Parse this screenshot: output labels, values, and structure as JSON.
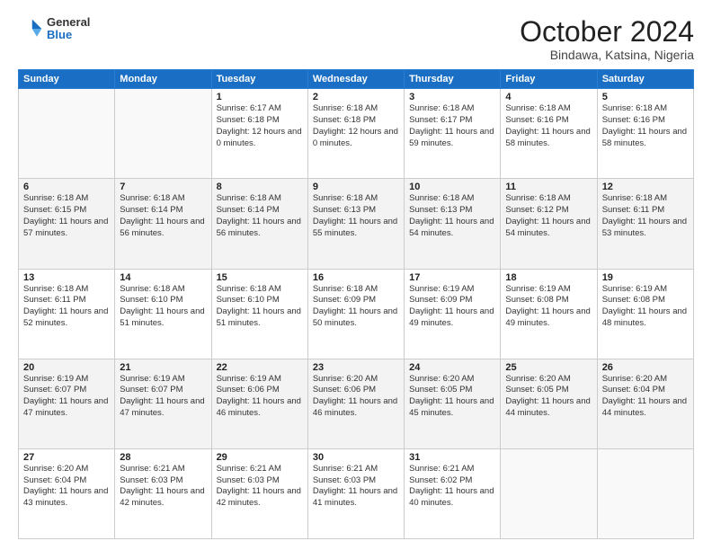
{
  "header": {
    "logo": {
      "general": "General",
      "blue": "Blue"
    },
    "title": "October 2024",
    "subtitle": "Bindawa, Katsina, Nigeria"
  },
  "weekdays": [
    "Sunday",
    "Monday",
    "Tuesday",
    "Wednesday",
    "Thursday",
    "Friday",
    "Saturday"
  ],
  "weeks": [
    [
      {
        "day": "",
        "sunrise": "",
        "sunset": "",
        "daylight": ""
      },
      {
        "day": "",
        "sunrise": "",
        "sunset": "",
        "daylight": ""
      },
      {
        "day": "1",
        "sunrise": "Sunrise: 6:17 AM",
        "sunset": "Sunset: 6:18 PM",
        "daylight": "Daylight: 12 hours and 0 minutes."
      },
      {
        "day": "2",
        "sunrise": "Sunrise: 6:18 AM",
        "sunset": "Sunset: 6:18 PM",
        "daylight": "Daylight: 12 hours and 0 minutes."
      },
      {
        "day": "3",
        "sunrise": "Sunrise: 6:18 AM",
        "sunset": "Sunset: 6:17 PM",
        "daylight": "Daylight: 11 hours and 59 minutes."
      },
      {
        "day": "4",
        "sunrise": "Sunrise: 6:18 AM",
        "sunset": "Sunset: 6:16 PM",
        "daylight": "Daylight: 11 hours and 58 minutes."
      },
      {
        "day": "5",
        "sunrise": "Sunrise: 6:18 AM",
        "sunset": "Sunset: 6:16 PM",
        "daylight": "Daylight: 11 hours and 58 minutes."
      }
    ],
    [
      {
        "day": "6",
        "sunrise": "Sunrise: 6:18 AM",
        "sunset": "Sunset: 6:15 PM",
        "daylight": "Daylight: 11 hours and 57 minutes."
      },
      {
        "day": "7",
        "sunrise": "Sunrise: 6:18 AM",
        "sunset": "Sunset: 6:14 PM",
        "daylight": "Daylight: 11 hours and 56 minutes."
      },
      {
        "day": "8",
        "sunrise": "Sunrise: 6:18 AM",
        "sunset": "Sunset: 6:14 PM",
        "daylight": "Daylight: 11 hours and 56 minutes."
      },
      {
        "day": "9",
        "sunrise": "Sunrise: 6:18 AM",
        "sunset": "Sunset: 6:13 PM",
        "daylight": "Daylight: 11 hours and 55 minutes."
      },
      {
        "day": "10",
        "sunrise": "Sunrise: 6:18 AM",
        "sunset": "Sunset: 6:13 PM",
        "daylight": "Daylight: 11 hours and 54 minutes."
      },
      {
        "day": "11",
        "sunrise": "Sunrise: 6:18 AM",
        "sunset": "Sunset: 6:12 PM",
        "daylight": "Daylight: 11 hours and 54 minutes."
      },
      {
        "day": "12",
        "sunrise": "Sunrise: 6:18 AM",
        "sunset": "Sunset: 6:11 PM",
        "daylight": "Daylight: 11 hours and 53 minutes."
      }
    ],
    [
      {
        "day": "13",
        "sunrise": "Sunrise: 6:18 AM",
        "sunset": "Sunset: 6:11 PM",
        "daylight": "Daylight: 11 hours and 52 minutes."
      },
      {
        "day": "14",
        "sunrise": "Sunrise: 6:18 AM",
        "sunset": "Sunset: 6:10 PM",
        "daylight": "Daylight: 11 hours and 51 minutes."
      },
      {
        "day": "15",
        "sunrise": "Sunrise: 6:18 AM",
        "sunset": "Sunset: 6:10 PM",
        "daylight": "Daylight: 11 hours and 51 minutes."
      },
      {
        "day": "16",
        "sunrise": "Sunrise: 6:18 AM",
        "sunset": "Sunset: 6:09 PM",
        "daylight": "Daylight: 11 hours and 50 minutes."
      },
      {
        "day": "17",
        "sunrise": "Sunrise: 6:19 AM",
        "sunset": "Sunset: 6:09 PM",
        "daylight": "Daylight: 11 hours and 49 minutes."
      },
      {
        "day": "18",
        "sunrise": "Sunrise: 6:19 AM",
        "sunset": "Sunset: 6:08 PM",
        "daylight": "Daylight: 11 hours and 49 minutes."
      },
      {
        "day": "19",
        "sunrise": "Sunrise: 6:19 AM",
        "sunset": "Sunset: 6:08 PM",
        "daylight": "Daylight: 11 hours and 48 minutes."
      }
    ],
    [
      {
        "day": "20",
        "sunrise": "Sunrise: 6:19 AM",
        "sunset": "Sunset: 6:07 PM",
        "daylight": "Daylight: 11 hours and 47 minutes."
      },
      {
        "day": "21",
        "sunrise": "Sunrise: 6:19 AM",
        "sunset": "Sunset: 6:07 PM",
        "daylight": "Daylight: 11 hours and 47 minutes."
      },
      {
        "day": "22",
        "sunrise": "Sunrise: 6:19 AM",
        "sunset": "Sunset: 6:06 PM",
        "daylight": "Daylight: 11 hours and 46 minutes."
      },
      {
        "day": "23",
        "sunrise": "Sunrise: 6:20 AM",
        "sunset": "Sunset: 6:06 PM",
        "daylight": "Daylight: 11 hours and 46 minutes."
      },
      {
        "day": "24",
        "sunrise": "Sunrise: 6:20 AM",
        "sunset": "Sunset: 6:05 PM",
        "daylight": "Daylight: 11 hours and 45 minutes."
      },
      {
        "day": "25",
        "sunrise": "Sunrise: 6:20 AM",
        "sunset": "Sunset: 6:05 PM",
        "daylight": "Daylight: 11 hours and 44 minutes."
      },
      {
        "day": "26",
        "sunrise": "Sunrise: 6:20 AM",
        "sunset": "Sunset: 6:04 PM",
        "daylight": "Daylight: 11 hours and 44 minutes."
      }
    ],
    [
      {
        "day": "27",
        "sunrise": "Sunrise: 6:20 AM",
        "sunset": "Sunset: 6:04 PM",
        "daylight": "Daylight: 11 hours and 43 minutes."
      },
      {
        "day": "28",
        "sunrise": "Sunrise: 6:21 AM",
        "sunset": "Sunset: 6:03 PM",
        "daylight": "Daylight: 11 hours and 42 minutes."
      },
      {
        "day": "29",
        "sunrise": "Sunrise: 6:21 AM",
        "sunset": "Sunset: 6:03 PM",
        "daylight": "Daylight: 11 hours and 42 minutes."
      },
      {
        "day": "30",
        "sunrise": "Sunrise: 6:21 AM",
        "sunset": "Sunset: 6:03 PM",
        "daylight": "Daylight: 11 hours and 41 minutes."
      },
      {
        "day": "31",
        "sunrise": "Sunrise: 6:21 AM",
        "sunset": "Sunset: 6:02 PM",
        "daylight": "Daylight: 11 hours and 40 minutes."
      },
      {
        "day": "",
        "sunrise": "",
        "sunset": "",
        "daylight": ""
      },
      {
        "day": "",
        "sunrise": "",
        "sunset": "",
        "daylight": ""
      }
    ]
  ]
}
